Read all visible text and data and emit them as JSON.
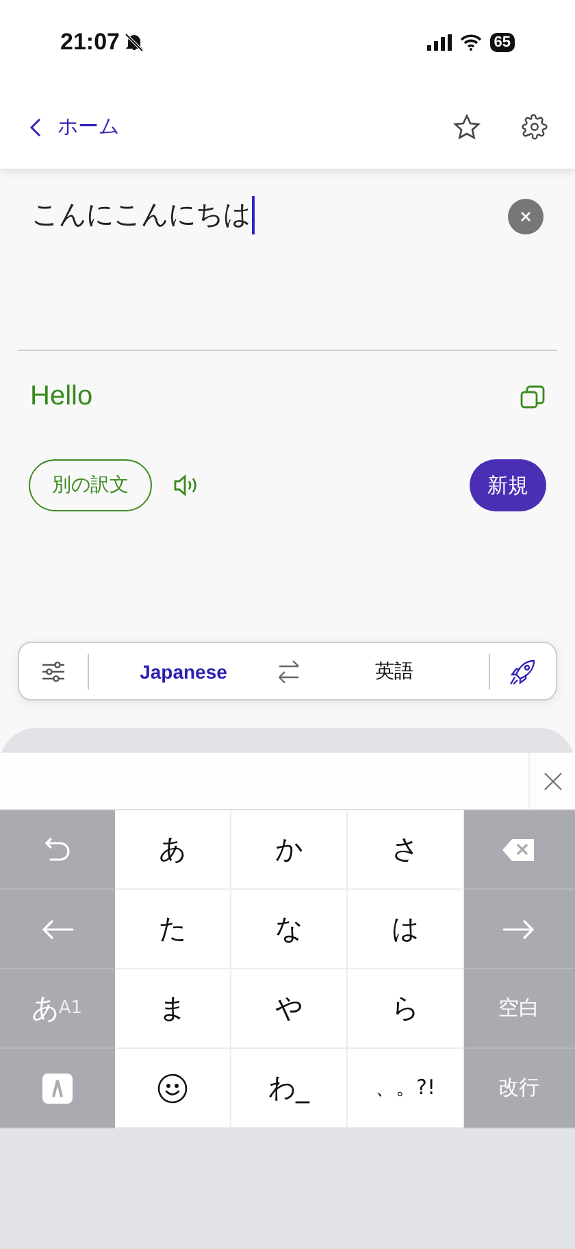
{
  "status_bar": {
    "time": "21:07",
    "battery": "65"
  },
  "nav": {
    "back_label": "ホーム"
  },
  "source": {
    "value": "こんにこんにちは"
  },
  "result": {
    "text": "Hello"
  },
  "actions": {
    "alternative": "別の訳文",
    "new": "新規"
  },
  "language_bar": {
    "source": "Japanese",
    "target": "英語"
  },
  "keyboard": {
    "rows": [
      [
        {
          "kind": "undo",
          "side": true
        },
        {
          "kind": "text",
          "label": "あ"
        },
        {
          "kind": "text",
          "label": "か"
        },
        {
          "kind": "text",
          "label": "さ"
        },
        {
          "kind": "backspace",
          "side": true
        }
      ],
      [
        {
          "kind": "left",
          "side": true
        },
        {
          "kind": "text",
          "label": "た"
        },
        {
          "kind": "text",
          "label": "な"
        },
        {
          "kind": "text",
          "label": "は"
        },
        {
          "kind": "right",
          "side": true
        }
      ],
      [
        {
          "kind": "mode",
          "label": "あ",
          "sub": "A1",
          "side": true
        },
        {
          "kind": "text",
          "label": "ま"
        },
        {
          "kind": "text",
          "label": "や"
        },
        {
          "kind": "text",
          "label": "ら"
        },
        {
          "kind": "text",
          "label": "空白",
          "side": true
        }
      ],
      [
        {
          "kind": "app",
          "side": true
        },
        {
          "kind": "smile"
        },
        {
          "kind": "text",
          "label": "わ_"
        },
        {
          "kind": "text",
          "label": "、。?!"
        },
        {
          "kind": "text",
          "label": "改行",
          "side": true
        }
      ]
    ]
  }
}
